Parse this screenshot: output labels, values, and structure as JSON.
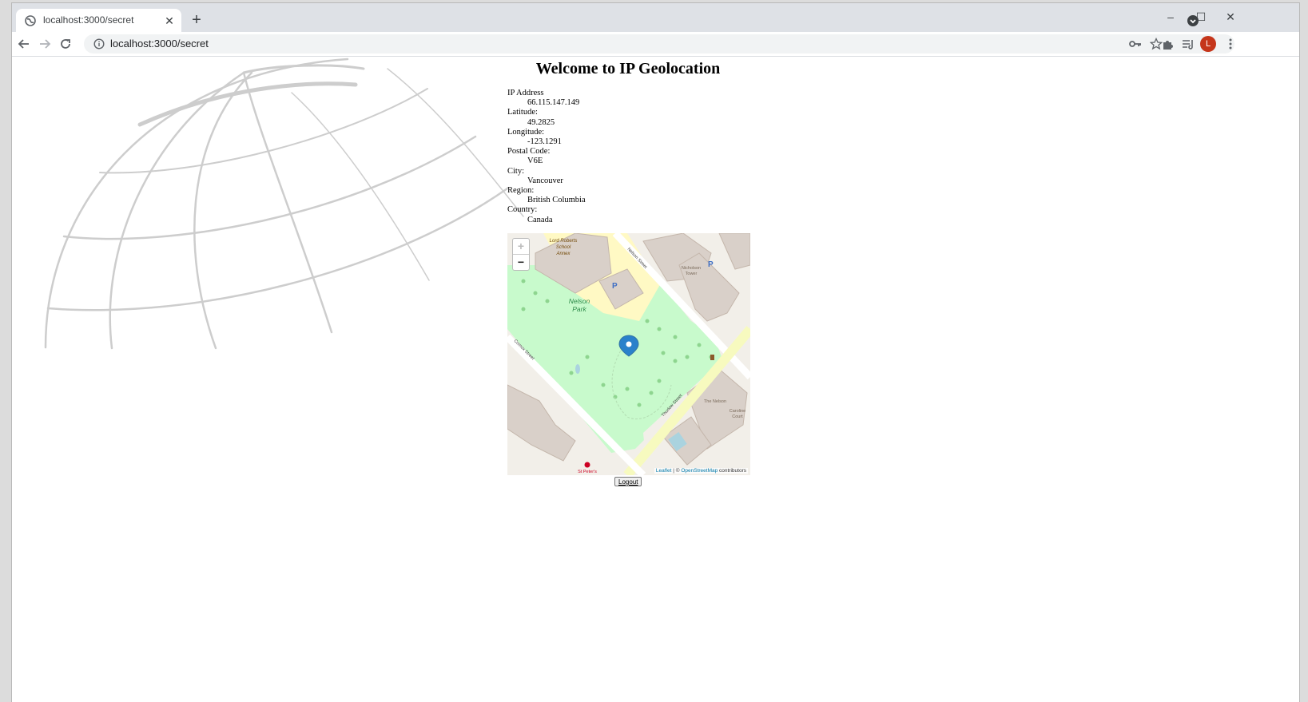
{
  "browser": {
    "tab_title": "localhost:3000/secret",
    "tab_close": "✕",
    "new_tab": "+",
    "url": "localhost:3000/secret",
    "profile_initial": "L",
    "window_controls": {
      "minimize": "–",
      "maximize": "☐",
      "close": "✕"
    }
  },
  "page": {
    "title": "Welcome to IP Geolocation",
    "fields": [
      {
        "label": "IP Address",
        "value": "66.115.147.149"
      },
      {
        "label": "Latitude:",
        "value": "49.2825"
      },
      {
        "label": "Longitude:",
        "value": "-123.1291"
      },
      {
        "label": "Postal Code:",
        "value": "V6E"
      },
      {
        "label": "City:",
        "value": "Vancouver"
      },
      {
        "label": "Region:",
        "value": "British Columbia"
      },
      {
        "label": "Country:",
        "value": "Canada"
      }
    ],
    "logout_label": "Logout"
  },
  "map": {
    "zoom_in": "+",
    "zoom_out": "−",
    "labels": {
      "school": [
        "Lord Roberts",
        "School",
        "Annex"
      ],
      "park": [
        "Nelson",
        "Park"
      ],
      "tower": [
        "Nicholson",
        "Tower"
      ],
      "nelson_st": "Nelson Street",
      "comox_st": "Comox Street",
      "thurlow_st": "Thurlow Street",
      "the_nelson": "The Nelson",
      "caroline": [
        "Caroline",
        "Court"
      ],
      "parking": "P",
      "church": "St Peter's"
    },
    "attribution": {
      "leaflet": "Leaflet",
      "separator": " | © ",
      "osm": "OpenStreetMap",
      "suffix": " contributors"
    },
    "colors": {
      "park": "#c8facc",
      "building": "#d9d0c9",
      "road_major": "#f7fabf",
      "marker": "#2a81cb"
    }
  },
  "icons": {
    "back": "arrow-left-icon",
    "forward": "arrow-right-icon",
    "reload": "reload-icon",
    "info": "info-icon",
    "key": "key-icon",
    "star": "star-icon",
    "extensions": "puzzle-icon",
    "reading_list": "reading-list-icon",
    "menu": "kebab-menu-icon"
  }
}
